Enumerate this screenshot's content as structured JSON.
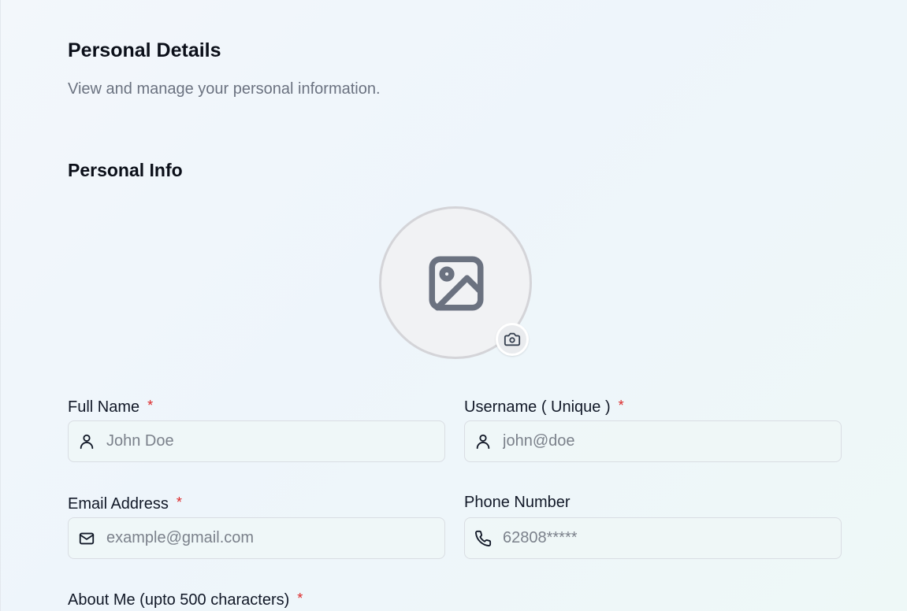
{
  "header": {
    "title": "Personal Details",
    "subtitle": "View and manage your personal information."
  },
  "section": {
    "title": "Personal Info"
  },
  "avatar": {
    "image_icon": "image-placeholder-icon",
    "camera_icon": "camera-icon"
  },
  "form": {
    "required_marker": "*",
    "full_name": {
      "label": "Full Name",
      "placeholder": "John Doe",
      "icon": "user-icon"
    },
    "username": {
      "label": "Username ( Unique )",
      "placeholder": "john@doe",
      "icon": "user-icon"
    },
    "email": {
      "label": "Email Address",
      "placeholder": "example@gmail.com",
      "icon": "mail-icon"
    },
    "phone": {
      "label": "Phone Number",
      "placeholder": "62808*****",
      "icon": "phone-icon"
    },
    "about": {
      "label": "About Me (upto 500 characters)"
    }
  },
  "colors": {
    "required": "#dc2626",
    "placeholder": "#7b818b",
    "icon": "#6b7280"
  }
}
